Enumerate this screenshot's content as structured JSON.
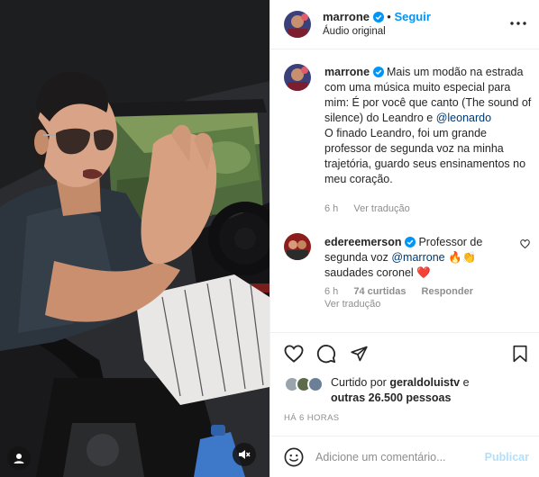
{
  "post": {
    "author": "marrone",
    "follow_label": "Seguir",
    "audio_label": "Áudio original"
  },
  "caption": {
    "author": "marrone",
    "text_before": "Mais um modão na estrada com uma música muito especial para mim: É por você que canto (The sound of silence) do Leandro e ",
    "mention": "@leonardo",
    "text_after": "O finado Leandro, foi um grande professor de segunda voz na minha trajetória, guardo seus ensinamentos no meu coração.",
    "time": "6 h",
    "translate_label": "Ver tradução"
  },
  "comment": {
    "author": "edereemerson",
    "text_before": "Professor de segunda voz ",
    "mention": "@marrone",
    "emojis_1": "🔥👏",
    "text_after": "saudades coronel",
    "emoji_2": "❤️",
    "time": "6 h",
    "likes": "74 curtidas",
    "reply_label": "Responder",
    "translate_label": "Ver tradução"
  },
  "likes": {
    "prefix": "Curtido por",
    "user": "geraldoluistv",
    "middle": "e",
    "rest": "outras 26.500 pessoas"
  },
  "time_ago": "HÁ 6 HORAS",
  "composer": {
    "placeholder": "Adicione um comentário...",
    "post_label": "Publicar"
  },
  "icons": {
    "verified": "verified-badge-icon",
    "more": "more-options-icon",
    "heart": "heart-icon",
    "comment": "comment-icon",
    "share": "share-icon",
    "save": "bookmark-icon",
    "emoji": "emoji-icon",
    "mute": "muted-audio-icon",
    "user_tag": "user-tag-icon",
    "comment_like": "small-heart-icon"
  },
  "colors": {
    "verified": "#0095f6",
    "link": "#00376b",
    "follow": "#0095f6",
    "post_disabled": "#b2dffc",
    "muted": "#8e8e8e"
  }
}
